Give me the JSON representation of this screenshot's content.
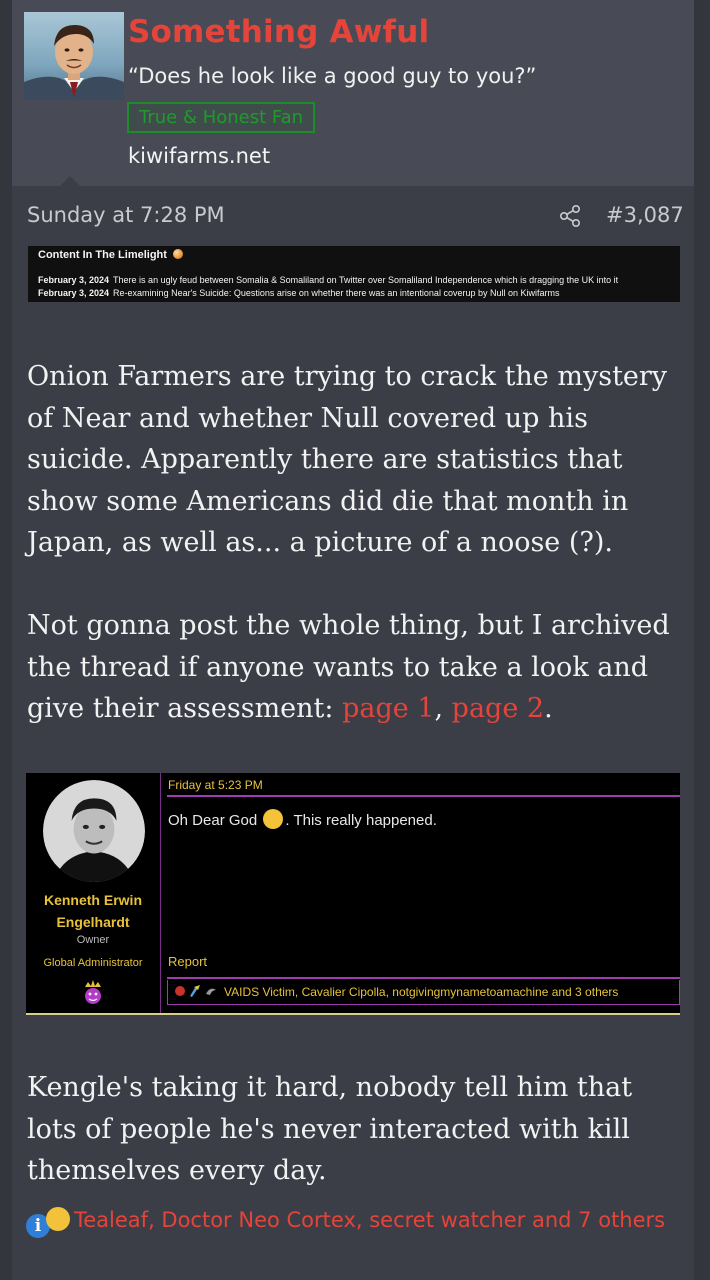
{
  "user": {
    "username": "Something Awful",
    "custom_title": "“Does he look like a good guy to you?”",
    "badge": "True & Honest Fan",
    "website": "kiwifarms.net"
  },
  "post": {
    "date": "Sunday at 7:28 PM",
    "number": "#3,087",
    "share_icon": "share-icon"
  },
  "limelight": {
    "title": "Content In The Limelight",
    "items": [
      {
        "date": "February 3, 2024",
        "text": "There is an ugly feud between Somalia & Somaliland on Twitter over Somaliland Independence which is dragging the UK into it"
      },
      {
        "date": "February 3, 2024",
        "text": "Re-examining Near's Suicide: Questions arise on whether there was an intentional coverup by Null on Kiwifarms"
      }
    ]
  },
  "body": {
    "para1": "Onion Farmers are trying to crack the mystery of Near and whether Null covered up his suicide. Apparently there are statistics that show some Americans did die that month in Japan, as well as... a picture of a noose (?).",
    "para2_before": "Not gonna post the whole thing, but I archived the thread if anyone wants to take a look and give their assessment: ",
    "link1": "page 1",
    "comma": ", ",
    "link2": "page 2",
    "period": ".",
    "para3": "Kengle's taking it hard, nobody tell him that lots of people he's never interacted with kill themselves every day."
  },
  "embed": {
    "name_line1": "Kenneth Erwin",
    "name_line2": "Engelhardt",
    "role1": "Owner",
    "role2": "Global Administrator",
    "date": "Friday at 5:23 PM",
    "msg_before": "Oh Dear God ",
    "msg_after": ". This really happened.",
    "report": "Report",
    "reactions": "VAIDS Victim, Cavalier Cipolla, notgivingmynametoamachine and 3 others"
  },
  "reactions": {
    "text": "Tealeaf, Doctor Neo Cortex, secret watcher and 7 others"
  },
  "colors": {
    "accent_red": "#e4443a",
    "badge_green": "#1f9b2c",
    "gold": "#e8c23a",
    "purple": "#a33bb0"
  }
}
